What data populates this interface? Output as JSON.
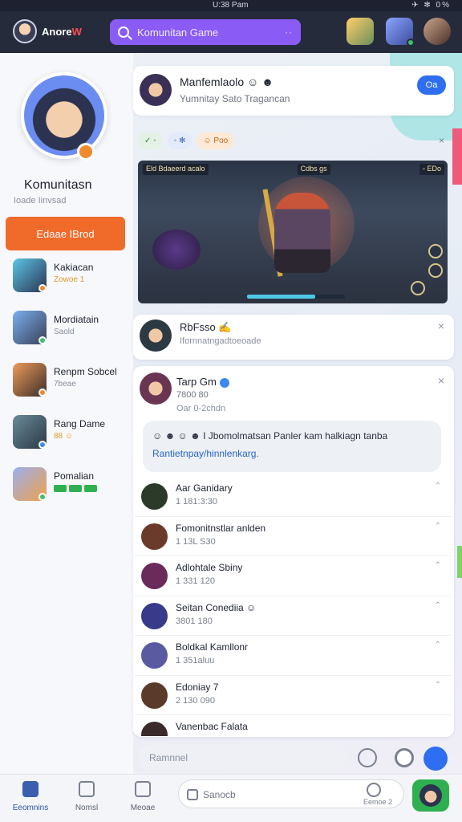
{
  "status": {
    "time": "U:38 Pam",
    "right": "✈ ✻ 0%"
  },
  "header": {
    "brand": "Anore",
    "brand_flame": "W",
    "search_placeholder": "Komunitan Game",
    "search_more": "··"
  },
  "profile": {
    "name": "Komunitasn",
    "sub": "Ioade Iinvsad",
    "follow_label": "Edaae IBrod"
  },
  "friends": [
    {
      "name": "Kakiacan",
      "sub": "Zowoe 1",
      "sub_style": "orange",
      "dot": "#f08a2a"
    },
    {
      "name": "Mordiatain",
      "sub": "Saold",
      "sub_style": "grey",
      "dot": "#3cc06a"
    },
    {
      "name": "Renpm Sobcel",
      "sub": "7beae",
      "sub_style": "grey",
      "dot": "#f08a2a"
    },
    {
      "name": "Rang  Dame",
      "sub": "88 ☺",
      "sub_style": "orange",
      "dot": "#3a8af0"
    },
    {
      "name": "Pomalian",
      "sub": "",
      "sub_style": "tags",
      "dot": "#3cc06a"
    }
  ],
  "post": {
    "title": "Manfemlaolo ☺ ☻",
    "sub": "Yumnitay Sato Tragancan",
    "button_label": "Oa"
  },
  "tags": [
    "✓ ◦",
    "◦ ✻",
    "☺ Poo"
  ],
  "tags_more": "×",
  "game": {
    "hud_left": "Eld  Bdaeerd acalo",
    "hud_mid": "Cdbs   gs",
    "hud_right": "◦ EDo"
  },
  "comment": {
    "name": "RbFsso ✍",
    "sub": "Ifornnatngadtoeoade"
  },
  "chat": {
    "name": "Tarp Gm",
    "sub1": "7800 80",
    "sub2": "Oar 0-2chdn",
    "bubble_line1": "☺ ☻ ☺ ☻ I  Jbomolmatsan Panler kam halkiagn  tanba",
    "bubble_line2": "Rantietnpay/hinnlenkarg.",
    "threads": [
      {
        "name": "Aar Ganidary",
        "sub": "1 181:3:30",
        "color": "#2c3a2a"
      },
      {
        "name": "Fomonitnstlar anlden",
        "sub": "1 13L  S30",
        "color": "#6a3a2a"
      },
      {
        "name": "Adlohtale Sbiny",
        "sub": "1 331  120",
        "color": "#6a2a5a"
      },
      {
        "name": "Seitan Conediia ☺",
        "sub": "3801 180",
        "color": "#3a3a8a"
      },
      {
        "name": "Boldkal Kamllonr",
        "sub": "1 351aluu",
        "color": "#5a5aa0"
      },
      {
        "name": "Edoniay 7",
        "sub": "2 130  090",
        "color": "#5a3a2a"
      },
      {
        "name": "Vanenbac Falata",
        "sub": "",
        "color": "#3a2a2a"
      }
    ]
  },
  "reply": {
    "placeholder": "Ramnnel"
  },
  "nav": {
    "items": [
      "Eeomnins",
      "Nomsl",
      "Meoae"
    ],
    "compose_placeholder": "Sanocb",
    "compose_label": "Eemoe 2"
  },
  "colors": {
    "accent": "#8a5cf5",
    "orange": "#f06a2a",
    "blue": "#2e6ef0",
    "green": "#2fb050"
  }
}
